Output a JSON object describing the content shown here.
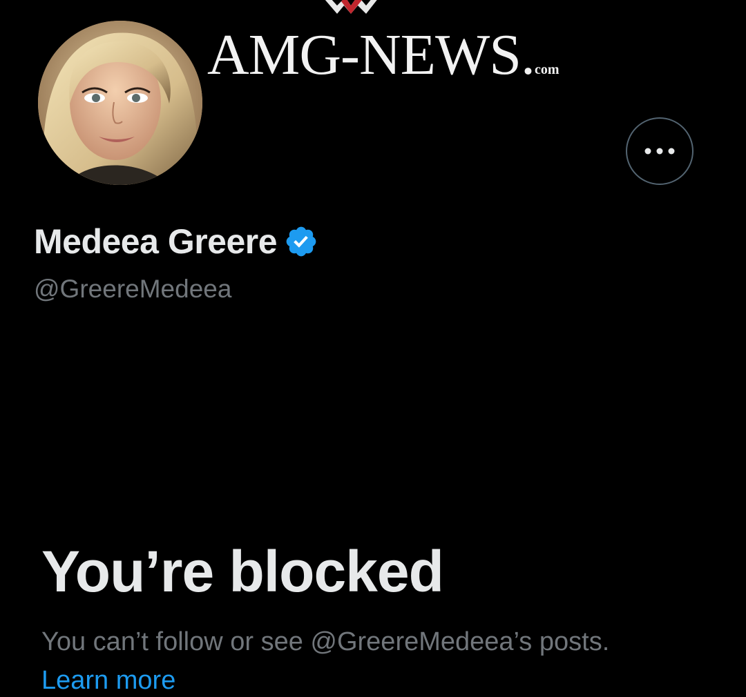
{
  "banner": {
    "logo_main": "AMG-NEWS.",
    "logo_suffix": "com"
  },
  "profile": {
    "display_name": "Medeea Greere",
    "handle": "@GreereMedeea",
    "verified": true,
    "avatar_icon": "profile-photo",
    "more_icon": "ellipsis-icon"
  },
  "blocked": {
    "title": "You’re blocked",
    "description": "You can’t follow or see @GreereMedeea’s posts.",
    "learn_more": "Learn more"
  },
  "colors": {
    "background": "#000000",
    "primary_text": "#e7e9ea",
    "secondary_text": "#71767b",
    "accent": "#1d9bf0",
    "border": "#536471"
  }
}
